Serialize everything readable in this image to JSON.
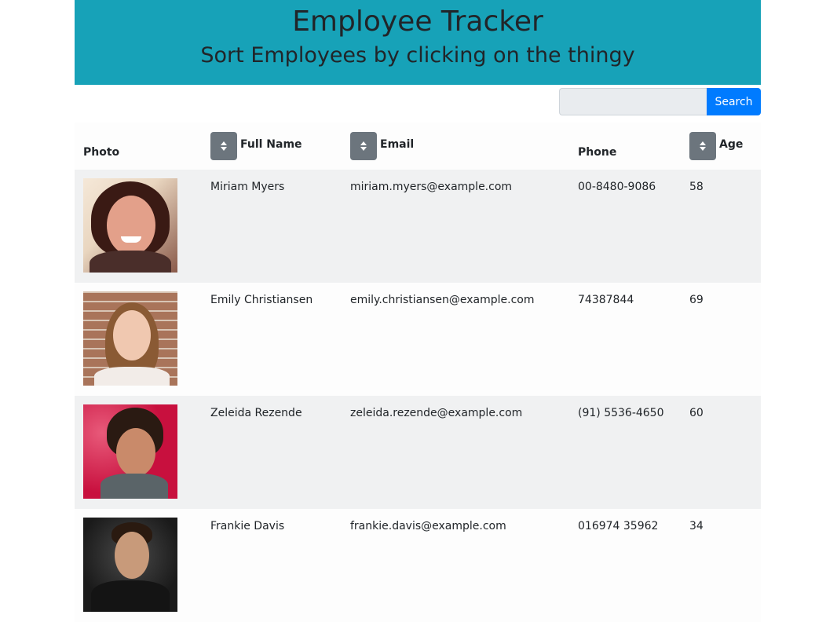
{
  "header": {
    "title": "Employee Tracker",
    "subtitle": "Sort Employees by clicking on the thingy"
  },
  "search": {
    "placeholder": "",
    "value": "",
    "button_label": "Search"
  },
  "table": {
    "columns": {
      "photo": "Photo",
      "name": "Full Name",
      "email": "Email",
      "phone": "Phone",
      "age": "Age"
    },
    "rows": [
      {
        "name": "Miriam Myers",
        "email": "miriam.myers@example.com",
        "phone": "00-8480-9086",
        "age": "58"
      },
      {
        "name": "Emily Christiansen",
        "email": "emily.christiansen@example.com",
        "phone": "74387844",
        "age": "69"
      },
      {
        "name": "Zeleida Rezende",
        "email": "zeleida.rezende@example.com",
        "phone": "(91) 5536-4650",
        "age": "60"
      },
      {
        "name": "Frankie Davis",
        "email": "frankie.davis@example.com",
        "phone": "016974 35962",
        "age": "34"
      }
    ]
  },
  "colors": {
    "header_bg": "#17a2b8",
    "search_button": "#007bff",
    "sort_button": "#6c757d"
  }
}
